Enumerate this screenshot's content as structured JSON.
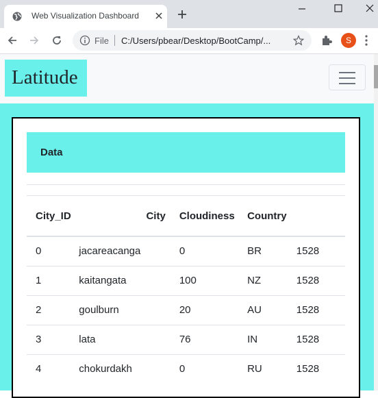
{
  "browser": {
    "tab_title": "Web Visualization Dashboard",
    "file_label": "File",
    "url": "C:/Users/pbear/Desktop/BootCamp/...",
    "profile_initial": "S",
    "colors": {
      "tabstrip": "#dee1e6",
      "profile": "#e8501a"
    }
  },
  "navbar": {
    "brand": "Latitude"
  },
  "card": {
    "header": "Data"
  },
  "table": {
    "columns": [
      "City_ID",
      "City",
      "Cloudiness",
      "Country"
    ],
    "rows": [
      [
        "0",
        "jacareacanga",
        "0",
        "BR",
        "1528"
      ],
      [
        "1",
        "kaitangata",
        "100",
        "NZ",
        "1528"
      ],
      [
        "2",
        "goulburn",
        "20",
        "AU",
        "1528"
      ],
      [
        "3",
        "lata",
        "76",
        "IN",
        "1528"
      ],
      [
        "4",
        "chokurdakh",
        "0",
        "RU",
        "1528"
      ]
    ]
  },
  "colors": {
    "accent": "#6af0eb",
    "border": "#000000"
  }
}
